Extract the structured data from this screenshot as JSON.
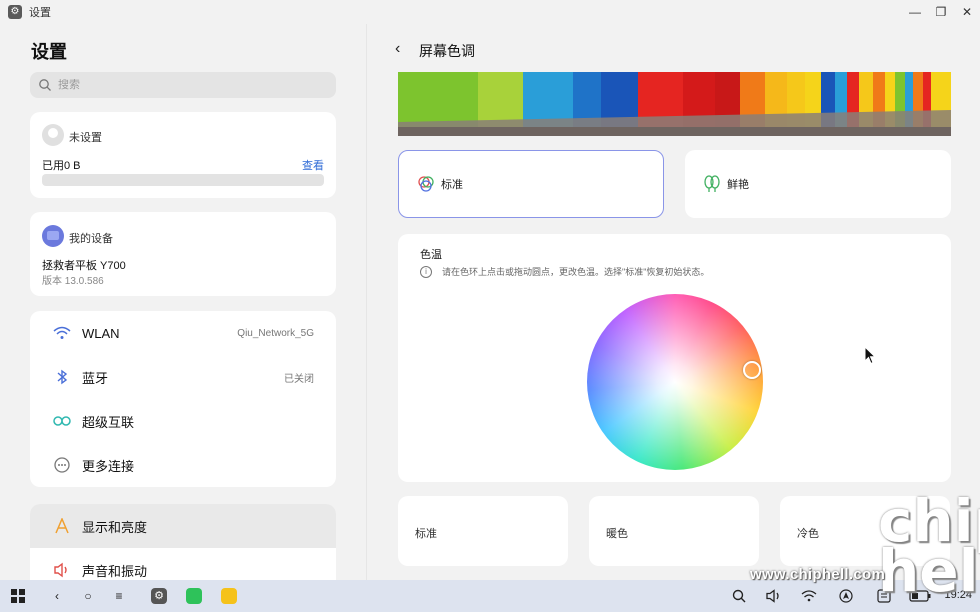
{
  "window": {
    "title": "设置"
  },
  "left": {
    "title": "设置",
    "search_placeholder": "搜索",
    "account": {
      "name": "未设置",
      "storage_used": "已用0 B",
      "view_link": "查看"
    },
    "device": {
      "label": "我的设备",
      "model": "拯救者平板 Y700",
      "version": "版本 13.0.586"
    },
    "connectivity": [
      {
        "label": "WLAN",
        "value": "Qiu_Network_5G",
        "icon": "wifi-icon"
      },
      {
        "label": "蓝牙",
        "value": "已关闭",
        "icon": "bluetooth-icon"
      },
      {
        "label": "超级互联",
        "value": "",
        "icon": "link-icon"
      },
      {
        "label": "更多连接",
        "value": "",
        "icon": "more-connections-icon"
      }
    ],
    "display": [
      {
        "label": "显示和亮度",
        "icon": "display-icon",
        "selected": true
      },
      {
        "label": "声音和振动",
        "icon": "speaker-icon",
        "selected": false
      }
    ]
  },
  "right": {
    "title": "屏幕色调",
    "modes": [
      {
        "label": "标准",
        "selected": true
      },
      {
        "label": "鲜艳",
        "selected": false
      }
    ],
    "color_temp": {
      "title": "色温",
      "hint": "请在色环上点击或拖动圆点，更改色温。选择\"标准\"恢复初始状态。"
    },
    "presets": [
      "标准",
      "暖色",
      "冷色"
    ]
  },
  "taskbar": {
    "clock": "19:24"
  },
  "watermark": {
    "url": "www.chiphell.com",
    "logo": "chip hell"
  },
  "colors": {
    "accent": "#8a95e8",
    "link": "#2f6bd6",
    "taskbar": "#dde3ef"
  }
}
